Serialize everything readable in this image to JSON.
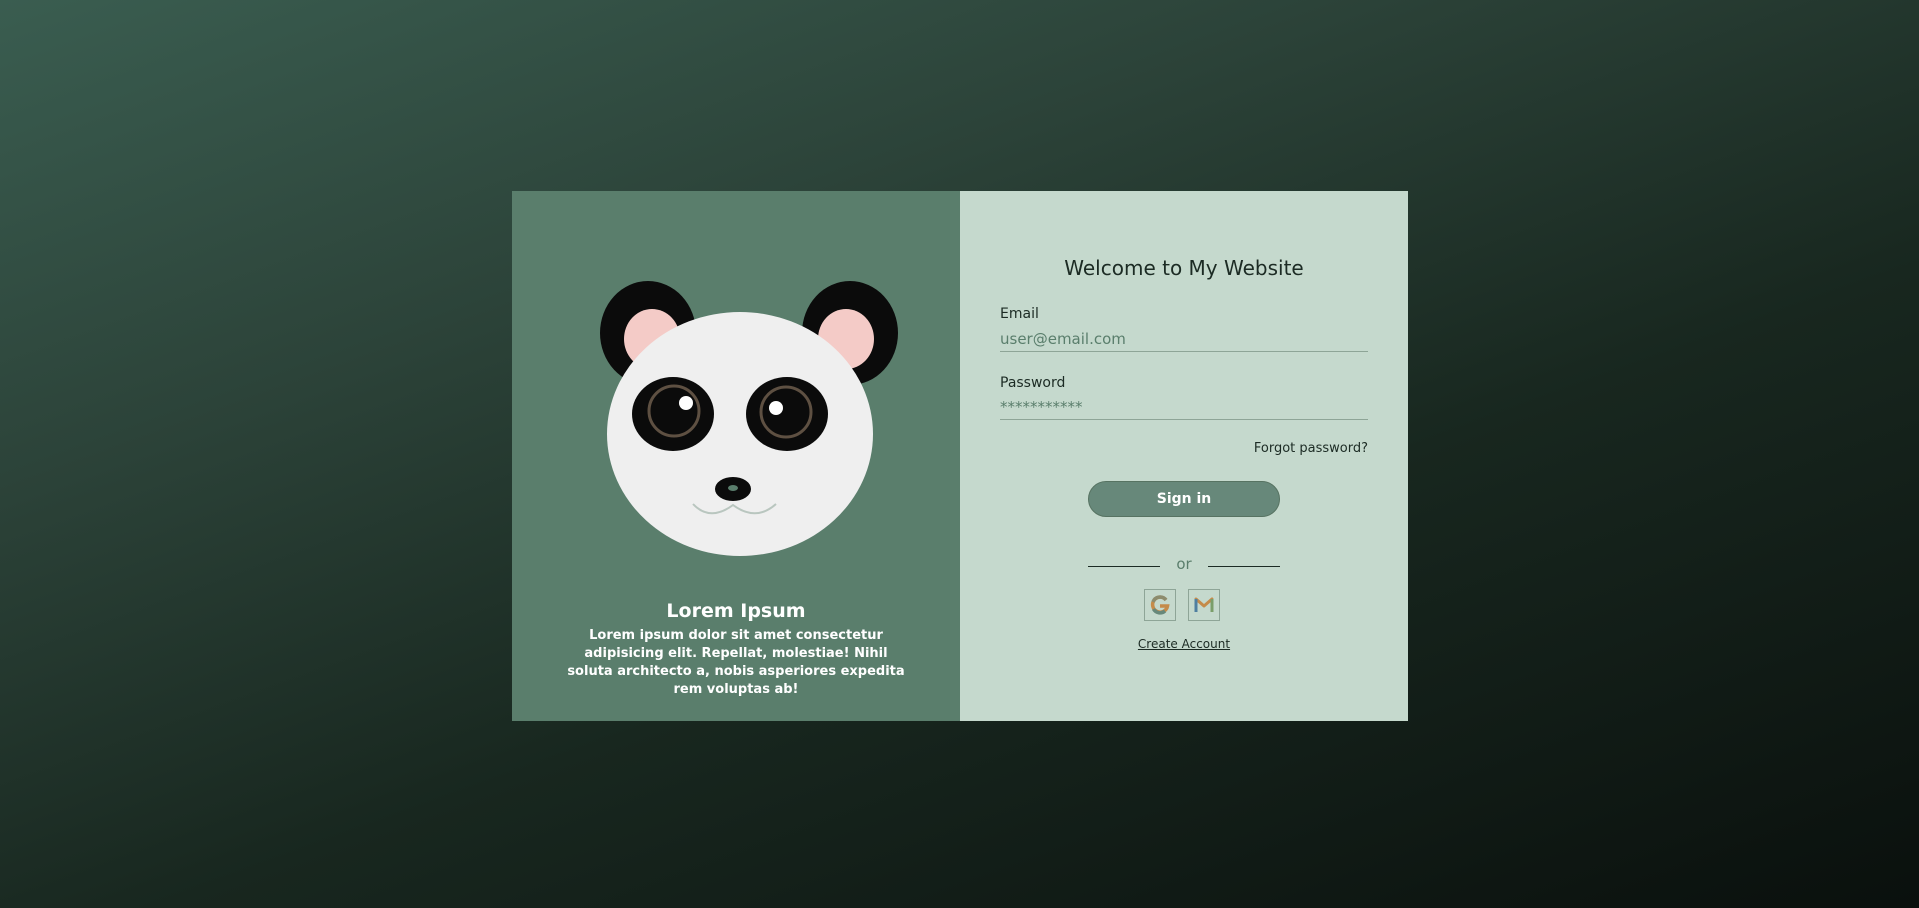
{
  "hero": {
    "title": "Lorem Ipsum",
    "description": "Lorem ipsum dolor sit amet consectetur adipisicing elit. Repellat, molestiae! Nihil soluta architecto a, nobis asperiores expedita rem voluptas ab!"
  },
  "form": {
    "heading": "Welcome to My Website",
    "email_label": "Email",
    "email_placeholder": "user@email.com",
    "password_label": "Password",
    "password_placeholder": "***********",
    "forgot_label": "Forgot password?",
    "signin_label": "Sign in",
    "or_label": "or",
    "social_icons": [
      "google-icon",
      "gmail-icon"
    ],
    "create_account_label": "Create Account"
  },
  "colors": {
    "left_panel": "#5a7e6c",
    "right_panel": "#c5d9cd",
    "button": "#67887a",
    "text_dark": "#1c2b24"
  }
}
